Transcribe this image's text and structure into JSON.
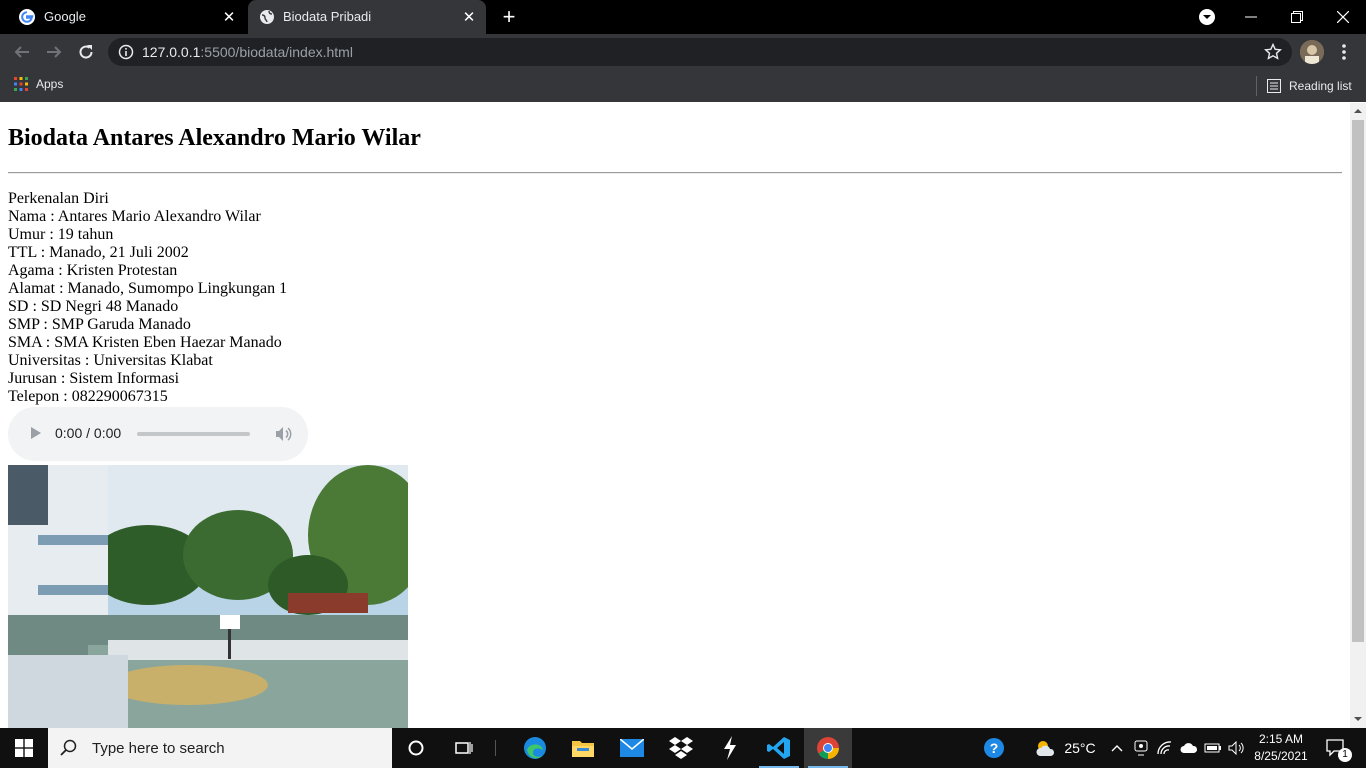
{
  "browser": {
    "tabs": [
      {
        "title": "Google",
        "favicon": "google-icon",
        "active": false
      },
      {
        "title": "Biodata Pribadi",
        "favicon": "globe-icon",
        "active": true
      }
    ],
    "url_host": "127.0.0.1",
    "url_rest": ":5500/biodata/index.html",
    "bookmarks": {
      "apps_label": "Apps",
      "reading_list_label": "Reading list"
    }
  },
  "page": {
    "heading": "Biodata Antares Alexandro Mario Wilar",
    "lines": [
      "Perkenalan Diri",
      "Nama : Antares Mario Alexandro Wilar",
      "Umur : 19 tahun",
      "TTL : Manado, 21 Juli 2002",
      "Agama : Kristen Protestan",
      "Alamat : Manado, Sumompo Lingkungan 1",
      "SD : SD Negri 48 Manado",
      "SMP : SMP Garuda Manado",
      "SMA : SMA Kristen Eben Haezar Manado",
      "Universitas : Universitas Klabat",
      "Jurusan : Sistem Informasi",
      "Telepon : 082290067315"
    ],
    "audio": {
      "time": "0:00 / 0:00",
      "progress": 0
    },
    "photo_alt": ""
  },
  "taskbar": {
    "search_placeholder": "Type here to search",
    "weather": "25°C",
    "time": "2:15 AM",
    "date": "8/25/2021",
    "notification_count": "1"
  },
  "colors": {
    "tabstrip": "#000000",
    "toolbar": "#35363a",
    "omnibox": "#202124",
    "taskbar": "#101010",
    "accent": "#76b9ed"
  }
}
